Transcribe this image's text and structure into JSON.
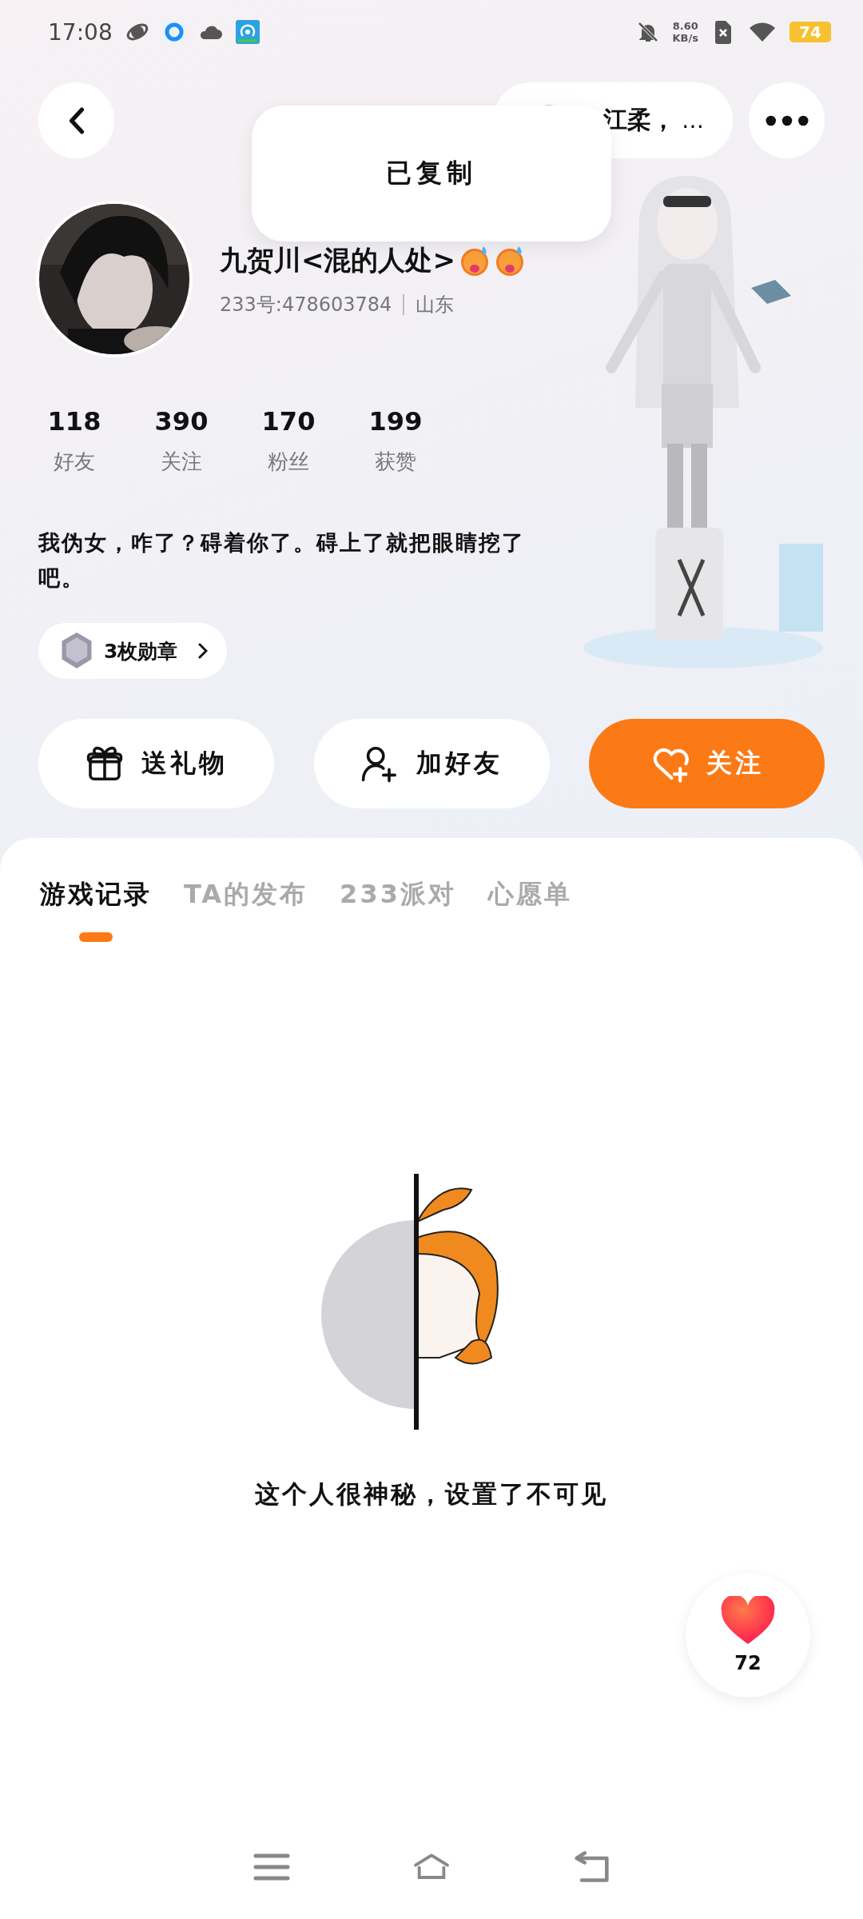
{
  "status_bar": {
    "time": "17:08",
    "net_speed": "8.60",
    "net_unit": "KB/s",
    "battery": "74"
  },
  "top_bar": {
    "chip_text": "江柔，",
    "chip_more": "…"
  },
  "toast": "已复制",
  "profile": {
    "name": "九贺川<混的人处>",
    "id": "233号:478603784",
    "region": "山东"
  },
  "stats": [
    {
      "value": "118",
      "label": "好友"
    },
    {
      "value": "390",
      "label": "关注"
    },
    {
      "value": "170",
      "label": "粉丝"
    },
    {
      "value": "199",
      "label": "获赞"
    }
  ],
  "bio": "我伪女，咋了？碍着你了。碍上了就把眼睛挖了吧。",
  "badge": {
    "label": "3枚勋章"
  },
  "actions": [
    {
      "kind": "gift",
      "label": "送礼物",
      "primary": false
    },
    {
      "kind": "add-friend",
      "label": "加好友",
      "primary": false
    },
    {
      "kind": "follow",
      "label": "关注",
      "primary": true
    }
  ],
  "tabs": [
    {
      "label": "游戏记录",
      "selected": true
    },
    {
      "label": "TA的发布",
      "selected": false
    },
    {
      "label": "233派对",
      "selected": false
    },
    {
      "label": "心愿单",
      "selected": false
    }
  ],
  "empty_message": "这个人很神秘，设置了不可见",
  "like_button": {
    "count": "72"
  }
}
